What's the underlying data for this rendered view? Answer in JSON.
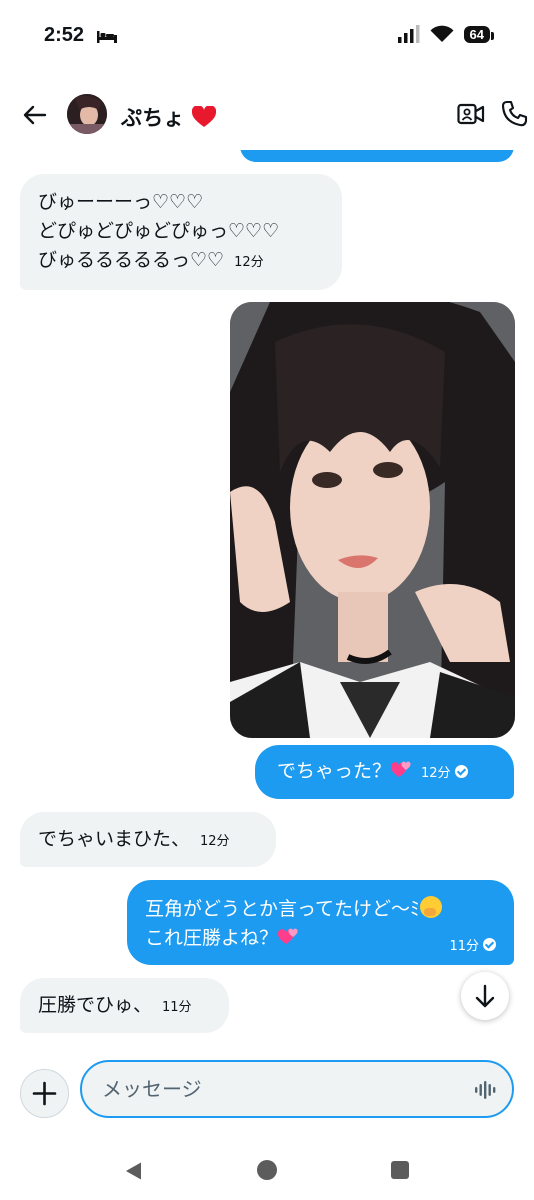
{
  "status_bar": {
    "time": "2:52",
    "battery": "64"
  },
  "header": {
    "name": "ぷちょ"
  },
  "messages": [
    {
      "direction": "in",
      "lines": [
        "びゅーーーっ♡♡♡",
        "どぴゅどぴゅどぴゅっ♡♡♡",
        "びゅるるるるるっ♡♡"
      ],
      "time": "12分"
    },
    {
      "direction": "out",
      "type": "image",
      "alt": ""
    },
    {
      "direction": "out",
      "text": "でちゃった？",
      "time": "12分"
    },
    {
      "direction": "in",
      "text": "でちゃいまひた、",
      "time": "12分"
    },
    {
      "direction": "out",
      "lines": [
        "互角がどうとか言ってたけど〜ﾐ",
        "これ圧勝よね？"
      ],
      "time": "11分"
    },
    {
      "direction": "in",
      "text": "圧勝でひゅ、",
      "time": "11分"
    }
  ],
  "composer": {
    "placeholder": "メッセージ"
  },
  "colors": {
    "accent": "#1d9bf0",
    "incoming_bubble": "#eff3f4",
    "heart": "#e8192c"
  },
  "icons": [
    "back-arrow-icon",
    "video-call-icon",
    "phone-icon",
    "plus-icon",
    "voice-wave-icon",
    "chevron-down-icon",
    "read-check-icon",
    "red-heart-icon",
    "two-hearts-icon",
    "hand-over-mouth-icon"
  ]
}
